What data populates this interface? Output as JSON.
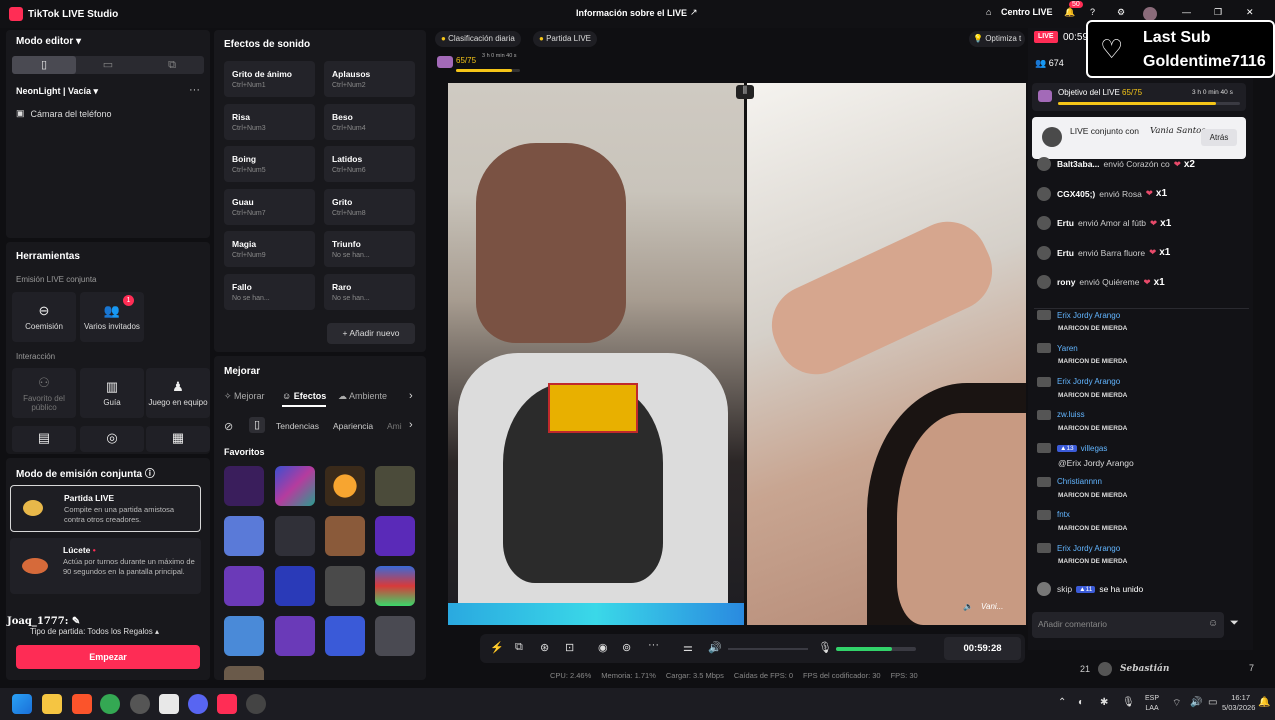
{
  "app": {
    "title": "TikTok LIVE Studio",
    "center_title": "Información sobre el LIVE",
    "centro_live": "Centro LIVE",
    "notif_count": "50"
  },
  "left": {
    "mode_editor": "Modo editor",
    "scene_name": "NeonLight | Vacía",
    "camera_source": "Cámara del teléfono"
  },
  "tools": {
    "title": "Herramientas",
    "section_joint": "Emisión LIVE conjunta",
    "coemision": "Coemisión",
    "varios": "Varios invitados",
    "varios_badge": "1",
    "section_interaction": "Interacción",
    "favorito": "Favorito del público",
    "guia": "Guía",
    "juego": "Juego en equipo"
  },
  "joint": {
    "title": "Modo de emisión conjunta",
    "partida_title": "Partida LIVE",
    "partida_desc": "Compite en una partida amistosa contra otros creadores.",
    "lucete_title": "Lúcete",
    "lucete_desc": "Actúa por turnos durante un máximo de 90 segundos en la pantalla principal.",
    "user_overlay": "Joaq_1777:",
    "tipo": "Tipo de partida: Todos los Regalos",
    "start_button": "Empezar"
  },
  "sounds": {
    "title": "Efectos de sonido",
    "items": [
      {
        "name": "Grito de ánimo",
        "key": "Ctrl+Num1"
      },
      {
        "name": "Aplausos",
        "key": "Ctrl+Num2"
      },
      {
        "name": "Risa",
        "key": "Ctrl+Num3"
      },
      {
        "name": "Beso",
        "key": "Ctrl+Num4"
      },
      {
        "name": "Boing",
        "key": "Ctrl+Num5"
      },
      {
        "name": "Latidos",
        "key": "Ctrl+Num6"
      },
      {
        "name": "Guau",
        "key": "Ctrl+Num7"
      },
      {
        "name": "Grito",
        "key": "Ctrl+Num8"
      },
      {
        "name": "Magia",
        "key": "Ctrl+Num9"
      },
      {
        "name": "Triunfo",
        "key": "No se han..."
      },
      {
        "name": "Fallo",
        "key": "No se han..."
      },
      {
        "name": "Raro",
        "key": "No se han..."
      }
    ],
    "add_button": "Añadir nuevo"
  },
  "enhance": {
    "title": "Mejorar",
    "tabs": [
      "Mejorar",
      "Efectos",
      "Ambiente"
    ],
    "subtabs": [
      "Tendencias",
      "Apariencia",
      "Ami"
    ],
    "favorites": "Favoritos"
  },
  "stage": {
    "daily_rank": "Clasificación diaria",
    "partida_live": "Partida LIVE",
    "optimize": "Optimiza t",
    "progress": "65/75",
    "progress_timer": "3 h 0 min 40 s",
    "progress_value": 0.87,
    "guest_label": "Vani...",
    "timer": "00:59:28",
    "mic_level": 0.7
  },
  "stats": {
    "cpu": "CPU: 2.46%",
    "mem": "Memoria: 1.71%",
    "upload": "Cargar: 3.5 Mbps",
    "fps_drop": "Caídas de FPS: 0",
    "fps_enc": "FPS del codificador: 30",
    "fps": "FPS: 30"
  },
  "right": {
    "live_badge": "LIVE",
    "live_time": "00:59",
    "viewers": "674",
    "overlay_line1": "Last Sub",
    "overlay_line2": "Goldentime7116",
    "goal_title": "Objetivo del LIVE",
    "goal_value": "65/75",
    "goal_timer": "3 h 0 min 40 s",
    "goal_progress": 0.87,
    "joint_text": "LIVE conjunto con",
    "joint_user": "Vania Santos",
    "back_button": "Atrás",
    "gifts": [
      {
        "user": "Balt3aba...",
        "text": "envió Corazón co",
        "mult": "x2"
      },
      {
        "user": "CGX405;)",
        "text": "envió Rosa",
        "mult": "x1"
      },
      {
        "user": "Ertu",
        "text": "envió Amor al fútb",
        "mult": "x1"
      },
      {
        "user": "Ertu",
        "text": "envió Barra fluore",
        "mult": "x1"
      },
      {
        "user": "rony",
        "text": "envió Quiéreme",
        "mult": "x1"
      }
    ],
    "chat": [
      {
        "user": "Erix Jordy Arango",
        "msg": "MARICON DE MIERDA"
      },
      {
        "user": "Yaren",
        "msg": "MARICON DE MIERDA"
      },
      {
        "user": "Erix Jordy Arango",
        "msg": "MARICON DE MIERDA"
      },
      {
        "user": "zw.luiss",
        "msg": "MARICON DE MIERDA"
      },
      {
        "user": "villegas",
        "level": "13",
        "msg": "@Erix Jordy Arango"
      },
      {
        "user": "Christiannnn",
        "msg": "MARICON DE MIERDA"
      },
      {
        "user": "fntx",
        "msg": "MARICON DE MIERDA"
      },
      {
        "user": "Erix Jordy Arango",
        "msg": "MARICON DE MIERDA"
      }
    ],
    "joined_user": "skip",
    "joined_level": "11",
    "joined_text": "se ha unido",
    "comment_placeholder": "Añadir comentario",
    "rank_pos": "21",
    "rank_user": "Sebastián",
    "rank_score": "7"
  },
  "taskbar": {
    "lang1": "ESP",
    "lang2": "LAA",
    "time": "16:17",
    "date": "5/03/2026"
  }
}
